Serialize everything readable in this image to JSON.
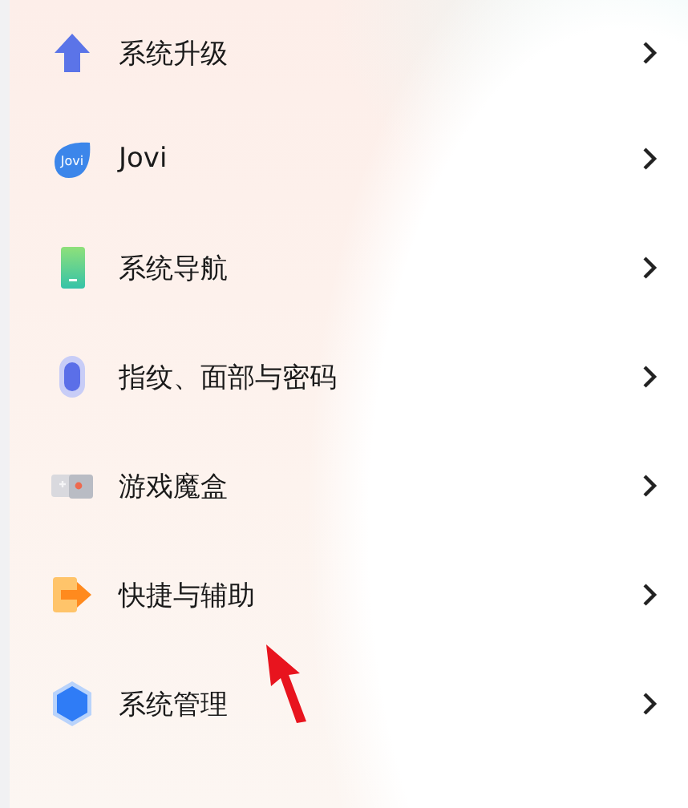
{
  "settings_items": [
    {
      "kind": "upgrade",
      "label": "系统升级"
    },
    {
      "kind": "jovi",
      "label": "Jovi",
      "icon_text": "Jovi"
    },
    {
      "kind": "navigation",
      "label": "系统导航"
    },
    {
      "kind": "fingerprint",
      "label": "指纹、面部与密码"
    },
    {
      "kind": "game",
      "label": "游戏魔盒"
    },
    {
      "kind": "shortcut",
      "label": "快捷与辅助"
    },
    {
      "kind": "management",
      "label": "系统管理"
    }
  ]
}
